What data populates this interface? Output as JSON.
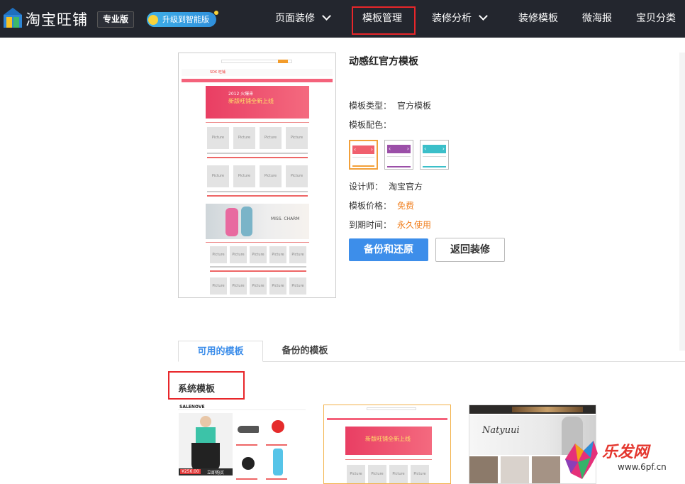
{
  "topbar": {
    "logo_text": "淘宝旺铺",
    "edition": "专业版",
    "upgrade": "升级到智能版",
    "nav": [
      {
        "label": "页面装修",
        "dropdown": true
      },
      {
        "label": "模板管理",
        "dropdown": false,
        "highlighted": true
      },
      {
        "label": "装修分析",
        "dropdown": true
      },
      {
        "label": "装修模板",
        "dropdown": false
      },
      {
        "label": "微海报",
        "dropdown": false
      },
      {
        "label": "宝贝分类",
        "dropdown": false
      }
    ]
  },
  "detail": {
    "title": "动感红官方模板",
    "type_label": "模板类型：",
    "type_value": "官方模板",
    "color_label": "模板配色：",
    "swatches": [
      {
        "color": "#f0606e",
        "selected": true
      },
      {
        "color": "#9b4fa8",
        "selected": false
      },
      {
        "color": "#3bbfc9",
        "selected": false
      }
    ],
    "designer_label": "设计师：",
    "designer_value": "淘宝官方",
    "price_label": "模板价格：",
    "price_value": "免费",
    "expire_label": "到期时间：",
    "expire_value": "永久使用",
    "primary_button": "备份和还原",
    "secondary_button": "返回装修"
  },
  "preview": {
    "logo": "SDK 旺铺",
    "banner_line1": "2012 火爆来",
    "banner_line2": "新版旺铺全新上线",
    "banner2_text": "MISS. CHARM",
    "placeholder": "Picture"
  },
  "tabs": [
    {
      "label": "可用的模板",
      "active": true
    },
    {
      "label": "备份的模板",
      "active": false
    }
  ],
  "section_title": "系统模板",
  "thumbs": {
    "t1_logo": "SALENOVE",
    "t1_price": "¥256.00",
    "t1_buy": "立即购买",
    "t2_banner": "新版旺铺全新上线",
    "t3_brand": "Natyuui"
  },
  "watermark": {
    "text": "乐发网",
    "url": "www.6pf.cn"
  },
  "colors": {
    "topbar": "#23262e",
    "accent": "#3d8eea",
    "highlight": "#e8262a",
    "orange": "#f07d1a"
  }
}
